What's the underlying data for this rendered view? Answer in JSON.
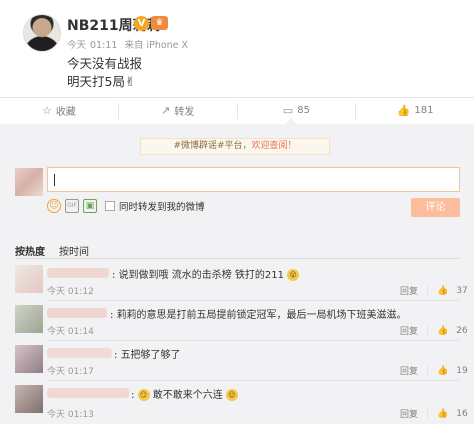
{
  "post": {
    "username": "NB211周莉莉",
    "meta_day": "今天",
    "meta_time": "01:11",
    "meta_source": "来自 iPhone X",
    "line1": "今天没有战报",
    "line2": "明天打5局✌"
  },
  "actions": {
    "favorite": "收藏",
    "repost": "转发",
    "comments": "85",
    "likes": "181"
  },
  "notice": {
    "prefix": "#微博辟谣#平台，",
    "link": "欢迎查阅！"
  },
  "composer": {
    "repost_label": "同时转发到我的微博",
    "submit_label": "评论"
  },
  "sort": {
    "hot": "按热度",
    "time": "按时间"
  },
  "comments": [
    {
      "text": "说到做到哦 流水的击杀榜 铁打的211",
      "time": "今天 01:12",
      "reply": "回复",
      "likes": "37"
    },
    {
      "text": "莉莉的意思是打前五局提前锁定冠军，最后一局机场下班美滋滋。",
      "time": "今天 01:14",
      "reply": "回复",
      "likes": "26"
    },
    {
      "text": "五把够了够了",
      "time": "今天 01:17",
      "reply": "回复",
      "likes": "19"
    },
    {
      "text": "敢不敢来个六连",
      "time": "今天 01:13",
      "reply": "回复",
      "likes": "16"
    }
  ],
  "colors": {
    "accent": "#eb7350",
    "submit_disabled": "#fdbd9c",
    "panel_bg": "#f2f2f5"
  }
}
